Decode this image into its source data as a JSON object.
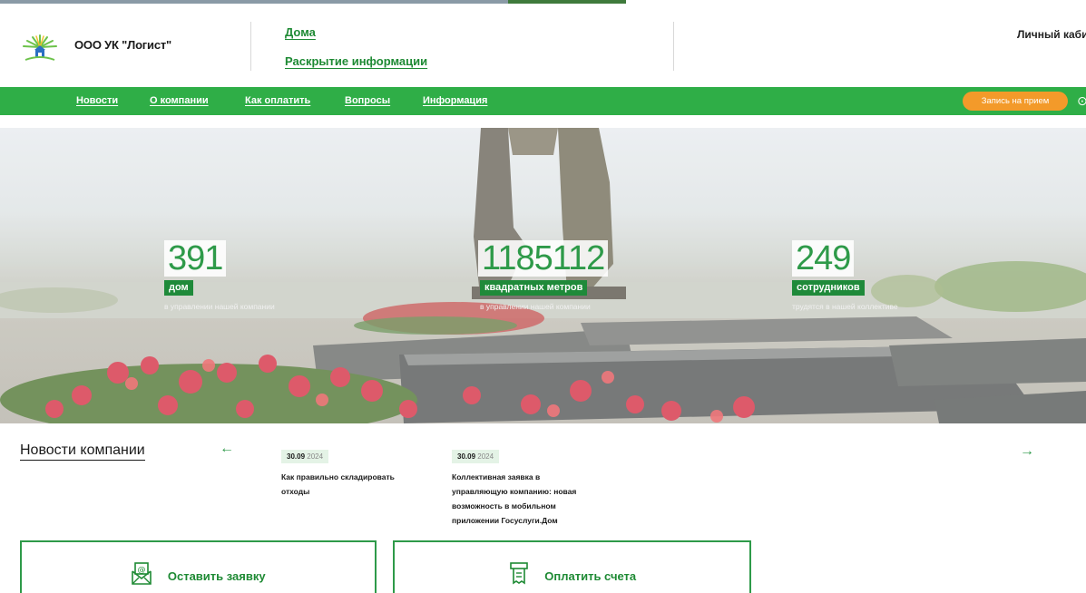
{
  "header": {
    "company_name": "ООО УК \"Логист\"",
    "links": [
      {
        "label": "Дома"
      },
      {
        "label": "Раскрытие информации"
      }
    ],
    "cabinet_label": "Личный кабин"
  },
  "nav": {
    "items": [
      {
        "label": "Новости"
      },
      {
        "label": "О компании"
      },
      {
        "label": "Как оплатить"
      },
      {
        "label": "Вопросы"
      },
      {
        "label": "Информация"
      }
    ],
    "appointment_label": "Запись на прием"
  },
  "stats": [
    {
      "value": "391",
      "label": "дом",
      "sub": "в управлении нашей компании"
    },
    {
      "value": "1185112",
      "label": "квадратных метров",
      "sub": "в управлении нашей компании"
    },
    {
      "value": "249",
      "label": "сотрудников",
      "sub": "трудятся в нашей коллективе"
    }
  ],
  "news": {
    "title": "Новости компании",
    "items": [
      {
        "date": "30.09",
        "year": "2024",
        "text_lines": [
          "Как правильно складировать",
          "отходы"
        ]
      },
      {
        "date": "30.09",
        "year": "2024",
        "text_lines": [
          "Коллективная заявка в",
          "управляющую компанию: новая",
          "возможность в мобильном",
          "приложении Госуслуги.Дом"
        ]
      }
    ]
  },
  "actions": [
    {
      "label": "Оставить заявку",
      "icon": "envelope-icon"
    },
    {
      "label": "Оплатить счета",
      "icon": "bill-icon"
    }
  ],
  "colors": {
    "brand_green": "#2fae47",
    "dark_green": "#1e8a34",
    "orange": "#f39a2a"
  }
}
